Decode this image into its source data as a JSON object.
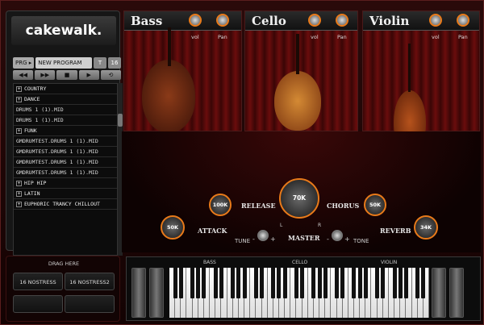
{
  "app": {
    "logo": "cakewalk."
  },
  "program": {
    "prg_label": "PRG ▸",
    "name": "NEW PROGRAM",
    "t_btn": "T",
    "num_btn": "16"
  },
  "transport": [
    {
      "icon": "rewind-icon",
      "glyph": "◀◀"
    },
    {
      "icon": "fast-forward-icon",
      "glyph": "▶▶"
    },
    {
      "icon": "stop-icon",
      "glyph": "■"
    },
    {
      "icon": "play-icon",
      "glyph": "▶"
    },
    {
      "icon": "loop-icon",
      "glyph": "⟲"
    }
  ],
  "filelist": [
    {
      "text": "COUNTRY",
      "folder": true
    },
    {
      "text": "DANCE",
      "folder": true
    },
    {
      "text": "DRUMS 1 (1).MID",
      "folder": false
    },
    {
      "text": "DRUMS 1 (1).MID",
      "folder": false
    },
    {
      "text": "FUNK",
      "folder": true
    },
    {
      "text": "GMDRUMTEST.DRUMS 1 (1).MID",
      "folder": false
    },
    {
      "text": "GMDRUMTEST.DRUMS 1 (1).MID",
      "folder": false
    },
    {
      "text": "GMDRUMTEST.DRUMS 1 (1).MID",
      "folder": false
    },
    {
      "text": "GMDRUMTEST.DRUMS 1 (1).MID",
      "folder": false
    },
    {
      "text": "HIP HIP",
      "folder": true
    },
    {
      "text": "LATIN",
      "folder": true
    },
    {
      "text": "EUPHORIC TRANCY CHILLOUT",
      "folder": true
    }
  ],
  "drag": {
    "label": "DRAG HERE",
    "slots": [
      "16 NOSTRESS",
      "16 NOSTRESS2",
      "",
      ""
    ]
  },
  "instruments": [
    {
      "name": "Bass",
      "vol": "vol",
      "pan": "Pan",
      "body_color": "#6b2a12"
    },
    {
      "name": "Cello",
      "vol": "vol",
      "pan": "Pan",
      "body_color": "#b35f1c"
    },
    {
      "name": "Violin",
      "vol": "vol",
      "pan": "Pan",
      "body_color": "#8a3210"
    }
  ],
  "controls": {
    "release": {
      "label": "RELEASE",
      "value": "100K"
    },
    "master": {
      "label": "MASTER",
      "value": "70K",
      "l": "L",
      "r": "R"
    },
    "chorus": {
      "label": "CHORUS",
      "value": "50K"
    },
    "attack": {
      "label": "ATTACK",
      "value": "50K"
    },
    "reverb": {
      "label": "REVERB",
      "value": "34K"
    },
    "tune": {
      "label": "TUNE",
      "minus": "-",
      "plus": "+"
    },
    "tone": {
      "label": "TONE",
      "minus": "-",
      "plus": "+"
    }
  },
  "keyboard": {
    "labels": [
      "BASS",
      "CELLO",
      "VIOLIN"
    ],
    "white_keys": 45
  },
  "colors": {
    "accent": "#e87a1a",
    "curtain": "#6a0d0d"
  }
}
